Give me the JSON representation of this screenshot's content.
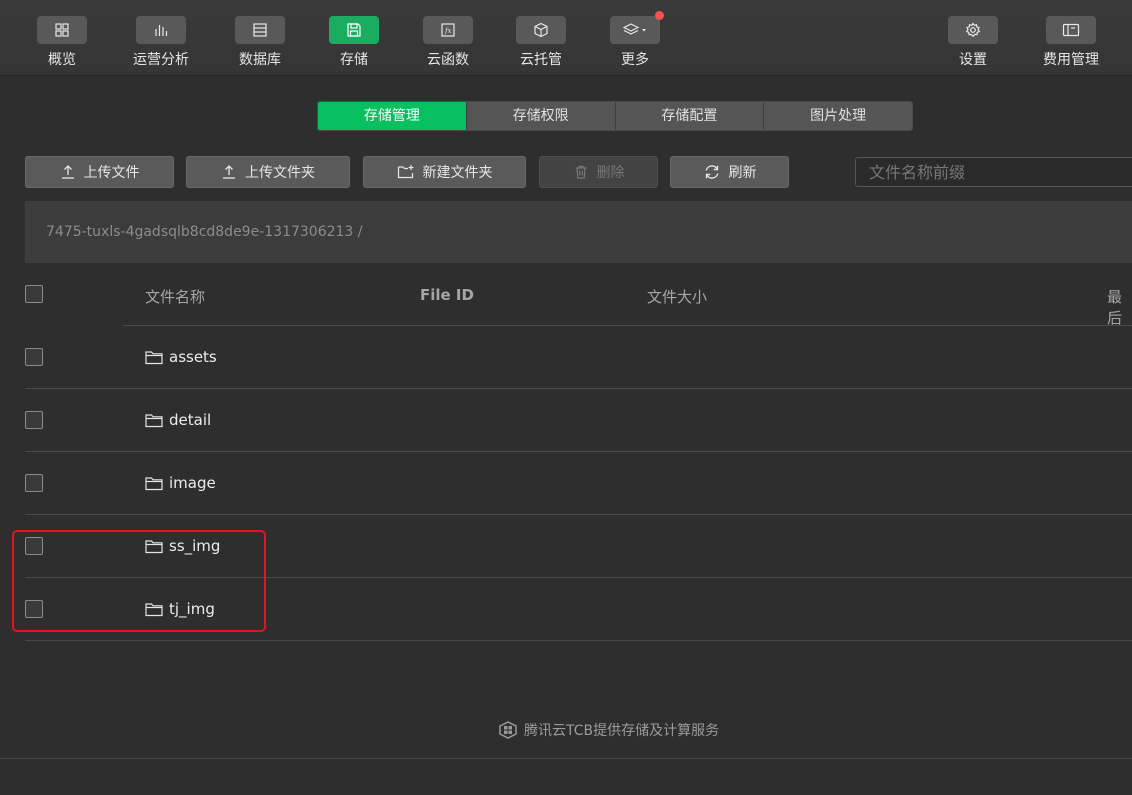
{
  "toolbar": {
    "items": [
      {
        "label": "概览",
        "icon": "grid-icon"
      },
      {
        "label": "运营分析",
        "icon": "bar-chart-icon"
      },
      {
        "label": "数据库",
        "icon": "database-icon"
      },
      {
        "label": "存储",
        "icon": "save-icon",
        "active": true
      },
      {
        "label": "云函数",
        "icon": "function-icon"
      },
      {
        "label": "云托管",
        "icon": "cube-icon"
      },
      {
        "label": "更多",
        "icon": "layers-icon",
        "has_dot": true
      },
      {
        "label": "设置",
        "icon": "gear-icon"
      },
      {
        "label": "费用管理",
        "icon": "billing-icon"
      }
    ]
  },
  "tabs": [
    "存储管理",
    "存储权限",
    "存储配置",
    "图片处理"
  ],
  "active_tab": "存储管理",
  "actions": {
    "upload_file": "上传文件",
    "upload_folder": "上传文件夹",
    "new_folder": "新建文件夹",
    "delete": "删除",
    "refresh": "刷新"
  },
  "search": {
    "placeholder": "文件名称前缀"
  },
  "breadcrumb": "7475-tuxls-4gadsqlb8cd8de9e-1317306213 /",
  "table": {
    "headers": {
      "name": "文件名称",
      "file_id": "File ID",
      "size": "文件大小",
      "last": "最后"
    },
    "rows": [
      {
        "name": "assets"
      },
      {
        "name": "detail"
      },
      {
        "name": "image"
      },
      {
        "name": "ss_img"
      },
      {
        "name": "tj_img"
      }
    ]
  },
  "footer": {
    "text": "腾讯云TCB提供存储及计算服务"
  },
  "colors": {
    "accent": "#07c160",
    "highlight": "#e5131a",
    "badge": "#fa5151"
  }
}
